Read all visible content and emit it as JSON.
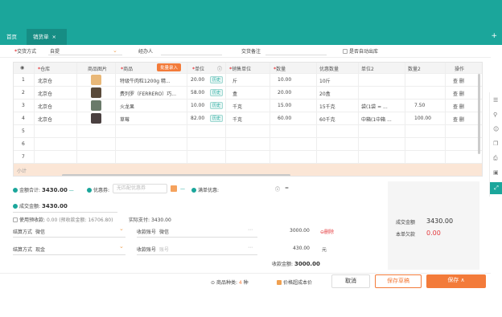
{
  "tabs": [
    {
      "label": "首页"
    },
    {
      "label": "销货单",
      "close": "×"
    }
  ],
  "top_plus": "+",
  "header_fields": {
    "settle_label": "交货方式",
    "settle_value": "自提",
    "handler_label": "经办人",
    "remark_label": "交货备注",
    "auto_label": "是否自动出库"
  },
  "table": {
    "headers": [
      "",
      "仓库",
      "商品图片",
      "商品",
      "单位",
      "",
      "销售单位",
      "数量",
      "优惠数量",
      "单位2",
      "数量2",
      "操作"
    ],
    "batch_button": "批量录入",
    "rows": [
      {
        "no": "1",
        "warehouse": "北京仓",
        "product": "特级牛肉粒1200g 精...",
        "price": "20.00",
        "unit_tag": "历史",
        "sales_unit": "斤",
        "qty": "10.00",
        "disc_qty": "10斤",
        "unit2": "",
        "qty2": "",
        "ops": "查 删"
      },
      {
        "no": "2",
        "warehouse": "北京仓",
        "product": "费列罗（FERRERO）巧...",
        "price": "58.00",
        "unit_tag": "历史",
        "sales_unit": "盒",
        "qty": "20.00",
        "disc_qty": "20盒",
        "unit2": "",
        "qty2": "",
        "ops": "查 删"
      },
      {
        "no": "3",
        "warehouse": "北京仓",
        "product": "火龙果",
        "price": "10.00",
        "unit_tag": "历史",
        "sales_unit": "千克",
        "qty": "15.00",
        "disc_qty": "15千克",
        "unit2": "袋(1袋 = ...",
        "qty2": "7.50",
        "ops": "查 删"
      },
      {
        "no": "4",
        "warehouse": "北京仓",
        "product": "草莓",
        "price": "82.00",
        "unit_tag": "历史",
        "sales_unit": "千克",
        "qty": "60.00",
        "disc_qty": "60千克",
        "unit2": "中箱(1中箱 ...",
        "qty2": "100.00",
        "ops": "查 删"
      },
      {
        "no": "5"
      },
      {
        "no": "6"
      },
      {
        "no": "7"
      }
    ],
    "subtotal_label": "小计"
  },
  "summary": {
    "total_label": "金额合计:",
    "total_value": "3430.00",
    "coupon_label": "优惠券:",
    "coupon_placeholder": "无匹配优惠券",
    "full_discount_label": "满单优惠:",
    "final_label": "成交金额:",
    "final_value": "3430.00",
    "deposit_label": "使用预收款:",
    "deposit_value": "0.00 (预收款金额: 16706.80)",
    "actual_label": "实际支付:",
    "actual_value": "3430.00",
    "settle_account_label": "结算方式",
    "settle_account_value": "微信",
    "account_no_label": "收款账号",
    "account_no_value": "微信",
    "amount1": "3000.00",
    "delete_label": "删除",
    "settle2_label": "结算方式",
    "settle2_value": "现金",
    "account2_label": "收款账号",
    "account2_placeholder": "账号",
    "amount2": "430.00",
    "unit2": "元",
    "received_label": "收款金额:",
    "received_value": "3000.00"
  },
  "right_panel": {
    "deal_label": "成交金额",
    "deal_value": "3430.00",
    "owe_label": "本单欠款",
    "owe_value": "0.00"
  },
  "footer": {
    "kinds_label": "商品种类:",
    "kinds_value": "4",
    "kinds_unit": "种",
    "check_label": "价格超成本价",
    "cancel_button": "取消",
    "draft_button": "保存草稿",
    "save_button": "保存 ∧"
  },
  "colors": {
    "brand": "#1ba69b",
    "accent": "#f37b3a",
    "danger": "#e4393c"
  },
  "sidebar_icons": [
    "list-icon",
    "link-icon",
    "smile-icon",
    "copy-icon",
    "printer-icon",
    "save-icon",
    "expand-icon"
  ]
}
